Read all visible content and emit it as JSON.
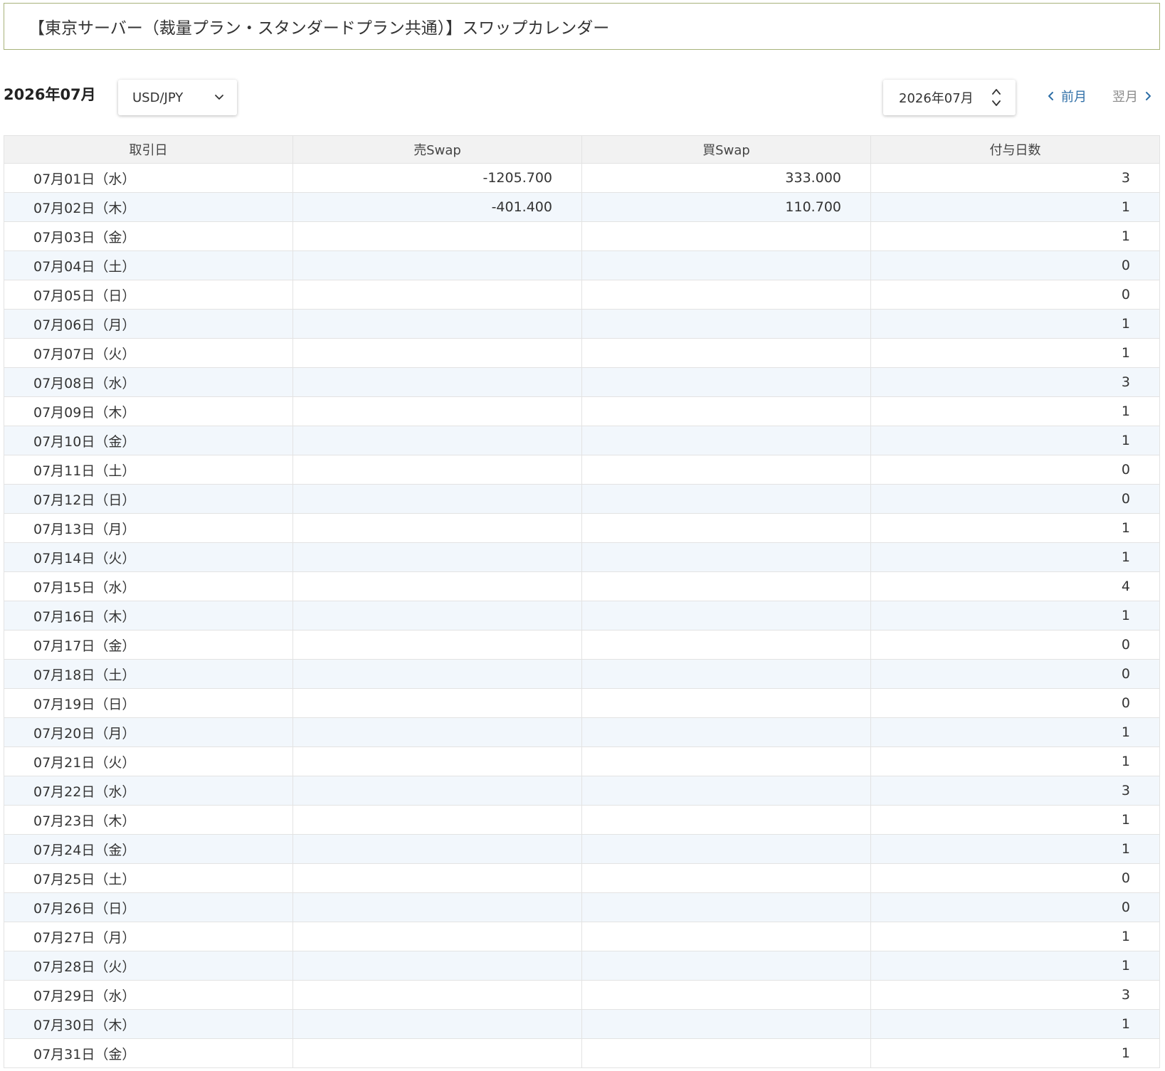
{
  "page": {
    "title": "【東京サーバー（裁量プラン・スタンダードプラン共通）】スワップカレンダー"
  },
  "toolbar": {
    "month_heading": "2026年07月",
    "currency_select": {
      "value": "USD/JPY",
      "icon": "chevron-down-icon"
    },
    "month_select": {
      "value": "2026年07月",
      "icon": "up-down-arrows-icon"
    },
    "prev_label": "前月",
    "next_label": "翌月",
    "colors": {
      "prev_link": "#2f6fa7",
      "next_link": "#8a8a8a",
      "title_border": "#a8b27a",
      "row_alt": "#f2f7fc"
    }
  },
  "table": {
    "headers": [
      "取引日",
      "売Swap",
      "買Swap",
      "付与日数"
    ],
    "rows": [
      {
        "date": "07月01日（水）",
        "sell": "-1205.700",
        "buy": "333.000",
        "days": "3"
      },
      {
        "date": "07月02日（木）",
        "sell": "-401.400",
        "buy": "110.700",
        "days": "1"
      },
      {
        "date": "07月03日（金）",
        "sell": "",
        "buy": "",
        "days": "1"
      },
      {
        "date": "07月04日（土）",
        "sell": "",
        "buy": "",
        "days": "0"
      },
      {
        "date": "07月05日（日）",
        "sell": "",
        "buy": "",
        "days": "0"
      },
      {
        "date": "07月06日（月）",
        "sell": "",
        "buy": "",
        "days": "1"
      },
      {
        "date": "07月07日（火）",
        "sell": "",
        "buy": "",
        "days": "1"
      },
      {
        "date": "07月08日（水）",
        "sell": "",
        "buy": "",
        "days": "3"
      },
      {
        "date": "07月09日（木）",
        "sell": "",
        "buy": "",
        "days": "1"
      },
      {
        "date": "07月10日（金）",
        "sell": "",
        "buy": "",
        "days": "1"
      },
      {
        "date": "07月11日（土）",
        "sell": "",
        "buy": "",
        "days": "0"
      },
      {
        "date": "07月12日（日）",
        "sell": "",
        "buy": "",
        "days": "0"
      },
      {
        "date": "07月13日（月）",
        "sell": "",
        "buy": "",
        "days": "1"
      },
      {
        "date": "07月14日（火）",
        "sell": "",
        "buy": "",
        "days": "1"
      },
      {
        "date": "07月15日（水）",
        "sell": "",
        "buy": "",
        "days": "4"
      },
      {
        "date": "07月16日（木）",
        "sell": "",
        "buy": "",
        "days": "1"
      },
      {
        "date": "07月17日（金）",
        "sell": "",
        "buy": "",
        "days": "0"
      },
      {
        "date": "07月18日（土）",
        "sell": "",
        "buy": "",
        "days": "0"
      },
      {
        "date": "07月19日（日）",
        "sell": "",
        "buy": "",
        "days": "0"
      },
      {
        "date": "07月20日（月）",
        "sell": "",
        "buy": "",
        "days": "1"
      },
      {
        "date": "07月21日（火）",
        "sell": "",
        "buy": "",
        "days": "1"
      },
      {
        "date": "07月22日（水）",
        "sell": "",
        "buy": "",
        "days": "3"
      },
      {
        "date": "07月23日（木）",
        "sell": "",
        "buy": "",
        "days": "1"
      },
      {
        "date": "07月24日（金）",
        "sell": "",
        "buy": "",
        "days": "1"
      },
      {
        "date": "07月25日（土）",
        "sell": "",
        "buy": "",
        "days": "0"
      },
      {
        "date": "07月26日（日）",
        "sell": "",
        "buy": "",
        "days": "0"
      },
      {
        "date": "07月27日（月）",
        "sell": "",
        "buy": "",
        "days": "1"
      },
      {
        "date": "07月28日（火）",
        "sell": "",
        "buy": "",
        "days": "1"
      },
      {
        "date": "07月29日（水）",
        "sell": "",
        "buy": "",
        "days": "3"
      },
      {
        "date": "07月30日（木）",
        "sell": "",
        "buy": "",
        "days": "1"
      },
      {
        "date": "07月31日（金）",
        "sell": "",
        "buy": "",
        "days": "1"
      }
    ]
  }
}
